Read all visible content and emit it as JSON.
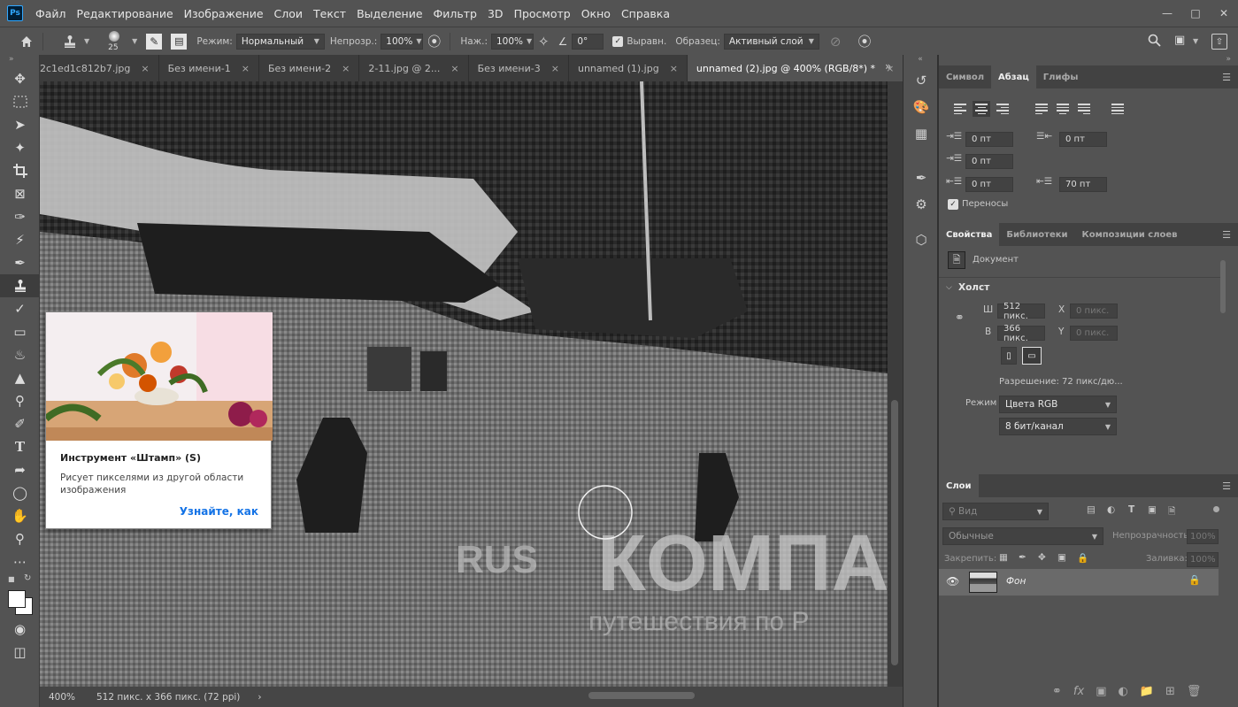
{
  "app": {
    "logo": "Ps"
  },
  "menu": [
    "Файл",
    "Редактирование",
    "Изображение",
    "Слои",
    "Текст",
    "Выделение",
    "Фильтр",
    "3D",
    "Просмотр",
    "Окно",
    "Справка"
  ],
  "options": {
    "brush_size": "25",
    "mode_label": "Режим:",
    "mode_value": "Нормальный",
    "opacity_label": "Непрозр.:",
    "opacity_value": "100%",
    "pressure_label": "Наж.:",
    "pressure_value": "100%",
    "angle_value": "0°",
    "aligned_label": "Выравн.",
    "sample_label": "Образец:",
    "sample_value": "Активный слой"
  },
  "tabs": [
    {
      "label": "2c1ed1c812b7.jpg",
      "active": false
    },
    {
      "label": "Без имени-1",
      "active": false
    },
    {
      "label": "Без имени-2",
      "active": false
    },
    {
      "label": "2-11.jpg @ 2...",
      "active": false
    },
    {
      "label": "Без имени-3",
      "active": false
    },
    {
      "label": "unnamed (1).jpg",
      "active": false
    },
    {
      "label": "unnamed (2).jpg @ 400% (RGB/8*) *",
      "active": true
    }
  ],
  "status": {
    "zoom": "400%",
    "doc_info": "512 пикс. x 366 пикс. (72 ppi)"
  },
  "tooltip": {
    "title": "Инструмент «Штамп» (S)",
    "description": "Рисует пикселями из другой области изображения",
    "link": "Узнайте, как"
  },
  "paragraph_panel": {
    "tabs": [
      "Символ",
      "Абзац",
      "Глифы"
    ],
    "active_tab": "Абзац",
    "indent_left": "0 пт",
    "indent_right": "0 пт",
    "indent_first": "0 пт",
    "space_before": "0 пт",
    "space_after": "70 пт",
    "hyphenate_label": "Переносы"
  },
  "properties_panel": {
    "tabs": [
      "Свойства",
      "Библиотеки",
      "Композиции слоев"
    ],
    "active_tab": "Свойства",
    "doc_label": "Документ",
    "canvas_header": "Холст",
    "w_label": "Ш",
    "w_value": "512 пикс.",
    "h_label": "В",
    "h_value": "366 пикс.",
    "x_label": "X",
    "x_placeholder": "0 пикс.",
    "y_label": "Y",
    "y_placeholder": "0 пикс.",
    "resolution": "Разрешение: 72 пикс/дю...",
    "mode_label": "Режим",
    "mode_value": "Цвета RGB",
    "depth_value": "8 бит/канал"
  },
  "layers_panel": {
    "tab": "Слои",
    "search_placeholder": "Вид",
    "blend_value": "Обычные",
    "opacity_label": "Непрозрачность:",
    "opacity_value": "100%",
    "lock_label": "Закрепить:",
    "fill_label": "Заливка:",
    "fill_value": "100%",
    "layers": [
      {
        "name": "Фон",
        "visible": true,
        "locked": true
      }
    ]
  },
  "colors": {
    "accent": "#31a8ff",
    "link": "#1473e6",
    "panel": "#535353",
    "dark": "#323232"
  }
}
